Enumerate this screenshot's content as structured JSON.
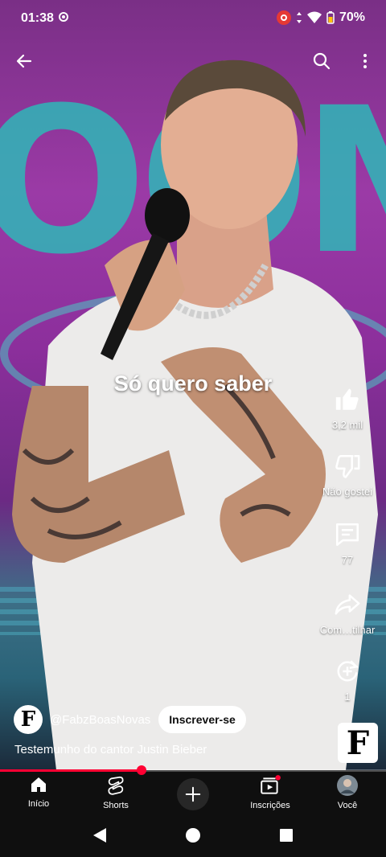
{
  "status": {
    "time": "01:38",
    "battery": "70%"
  },
  "video": {
    "caption": "Só quero saber",
    "title": "Testemunho do cantor Justin Bieber",
    "progress": 0.367
  },
  "actions": {
    "like_count": "3,2 mil",
    "dislike_label": "Não gostei",
    "comments_count": "77",
    "share_label": "Com…tilhar",
    "remix_count": "1"
  },
  "channel": {
    "handle": "@FabzBoasNovas",
    "avatar_letter": "F",
    "subscribe_label": "Inscrever-se"
  },
  "bottom_nav": {
    "home": "Início",
    "shorts": "Shorts",
    "subscriptions": "Inscrições",
    "you": "Você"
  },
  "colors": {
    "accent": "#ff0033",
    "nav_bg": "#0f0f0f"
  },
  "icons": [
    "back-arrow-icon",
    "search-icon",
    "more-vert-icon",
    "thumb-up-icon",
    "thumb-down-icon",
    "comment-icon",
    "share-icon",
    "remix-icon",
    "home-icon",
    "shorts-icon",
    "add-icon",
    "subscriptions-icon",
    "back-nav-icon",
    "home-nav-icon",
    "recents-nav-icon"
  ]
}
